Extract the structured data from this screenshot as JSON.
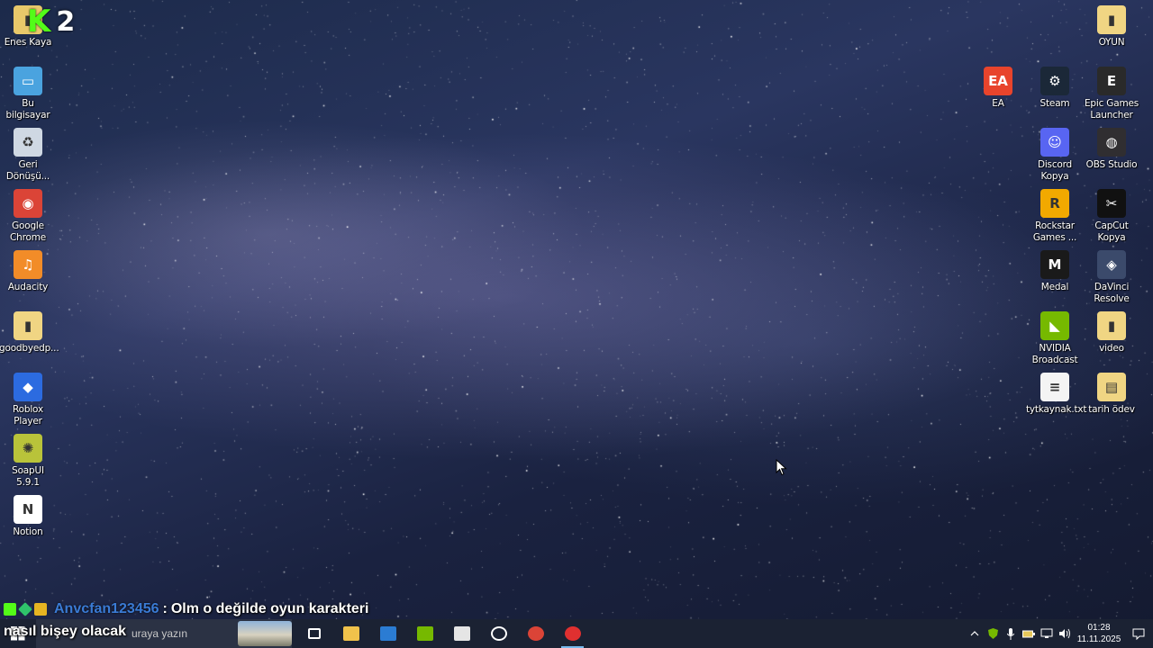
{
  "desktop": {
    "left_icons": [
      {
        "label": "Enes Kaya",
        "icon": "folder-user-icon",
        "color": "#e8c86a"
      },
      {
        "label": "Bu bilgisayar",
        "icon": "computer-icon",
        "color": "#4aa3df"
      },
      {
        "label": "Geri Dönüşü...",
        "icon": "recycle-bin-icon",
        "color": "#cfd8e3"
      },
      {
        "label": "Google Chrome",
        "icon": "chrome-icon",
        "color": "#db4437"
      },
      {
        "label": "Audacity",
        "icon": "audacity-icon",
        "color": "#f28c28"
      },
      {
        "label": "goodbyedp...",
        "icon": "folder-icon",
        "color": "#f0d583"
      },
      {
        "label": "Roblox Player",
        "icon": "roblox-icon",
        "color": "#2c6be0"
      },
      {
        "label": "SoapUI 5.9.1",
        "icon": "soapui-icon",
        "color": "#b9c33a"
      },
      {
        "label": "Notion",
        "icon": "notion-icon",
        "color": "#ffffff"
      }
    ],
    "right_icons": [
      {
        "label": "OYUN",
        "icon": "folder-icon",
        "color": "#f0d583"
      },
      {
        "label": "EA",
        "icon": "ea-icon",
        "color": "#e8442c"
      },
      {
        "label": "Steam",
        "icon": "steam-icon",
        "color": "#1b2838"
      },
      {
        "label": "Epic Games Launcher",
        "icon": "epic-games-icon",
        "color": "#2a2a2a"
      },
      {
        "label": "Discord Kopya",
        "icon": "discord-icon",
        "color": "#5865f2"
      },
      {
        "label": "OBS Studio",
        "icon": "obs-icon",
        "color": "#302e31"
      },
      {
        "label": "Rockstar Games ...",
        "icon": "rockstar-icon",
        "color": "#f2a900"
      },
      {
        "label": "CapCut Kopya",
        "icon": "capcut-icon",
        "color": "#111111"
      },
      {
        "label": "Medal",
        "icon": "medal-icon",
        "color": "#1a1a1a"
      },
      {
        "label": "DaVinci Resolve",
        "icon": "davinci-icon",
        "color": "#3b4a6b"
      },
      {
        "label": "NVIDIA Broadcast",
        "icon": "nvidia-icon",
        "color": "#76b900"
      },
      {
        "label": "video",
        "icon": "folder-icon",
        "color": "#f0d583"
      },
      {
        "label": "tytkaynak.txt",
        "icon": "text-file-icon",
        "color": "#f4f4f4"
      },
      {
        "label": "tarih ödev",
        "icon": "document-icon",
        "color": "#f0d583"
      }
    ],
    "kick_overlay": {
      "logo": "K",
      "number": "2"
    }
  },
  "chat": {
    "username": "Anvcfan123456",
    "separator": ":",
    "message_line1": "Olm o değilde oyun karakteri",
    "message_line2": "nasıl bişey olacak"
  },
  "taskbar": {
    "search_placeholder": "uraya yazın",
    "apps": [
      {
        "name": "task-view-icon",
        "active": false
      },
      {
        "name": "file-explorer-icon",
        "active": false
      },
      {
        "name": "microsoft-store-icon",
        "active": false
      },
      {
        "name": "nvidia-icon",
        "active": false
      },
      {
        "name": "epic-games-icon",
        "active": false
      },
      {
        "name": "obs-icon",
        "active": false
      },
      {
        "name": "chrome-icon",
        "active": false
      },
      {
        "name": "recording-app-icon",
        "active": true
      }
    ],
    "clock": {
      "time": "01:28",
      "date": "11.11.2025"
    }
  }
}
